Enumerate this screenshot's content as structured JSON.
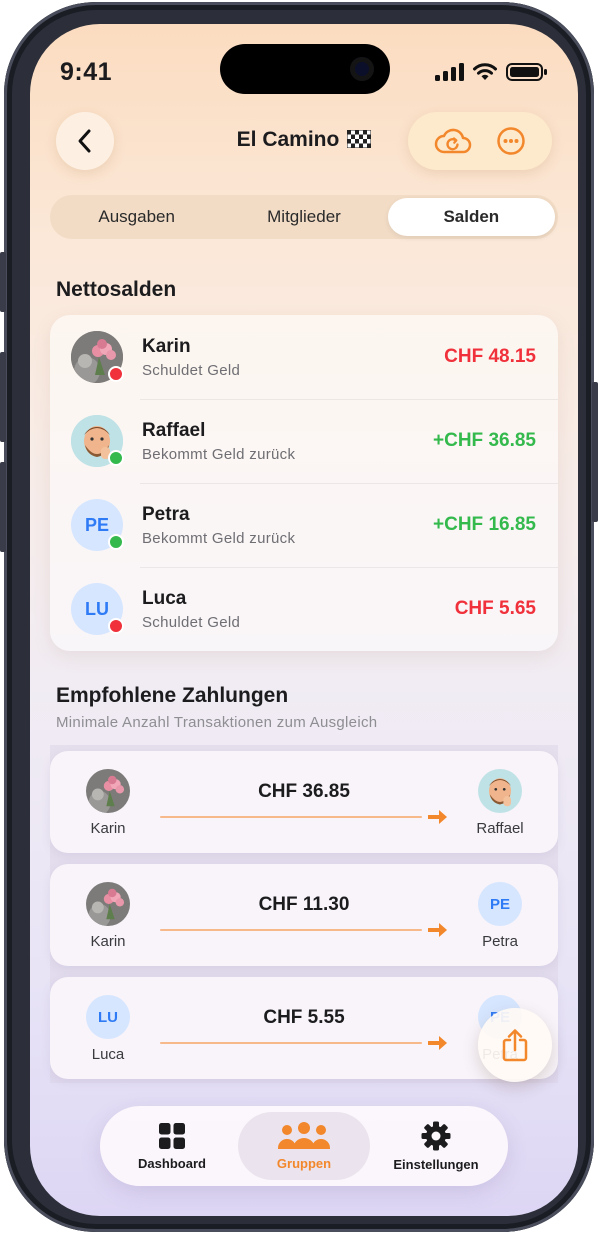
{
  "status_bar": {
    "time": "9:41"
  },
  "header": {
    "title": "El Camino",
    "flag_icon": "checkered-flag-icon"
  },
  "tabs": [
    {
      "label": "Ausgaben",
      "active": false
    },
    {
      "label": "Mitglieder",
      "active": false
    },
    {
      "label": "Salden",
      "active": true
    }
  ],
  "balances": {
    "title": "Nettosalden",
    "rows": [
      {
        "name": "Karin",
        "status": "Schuldet Geld",
        "amount": "CHF 48.15",
        "kind": "negative",
        "avatar": "photo-flowers"
      },
      {
        "name": "Raffael",
        "status": "Bekommt Geld zurück",
        "amount": "+CHF 36.85",
        "kind": "positive",
        "avatar": "memoji"
      },
      {
        "name": "Petra",
        "status": "Bekommt Geld zurück",
        "amount": "+CHF 16.85",
        "kind": "positive",
        "avatar": "PE"
      },
      {
        "name": "Luca",
        "status": "Schuldet Geld",
        "amount": "CHF 5.65",
        "kind": "negative",
        "avatar": "LU"
      }
    ]
  },
  "payments": {
    "title": "Empfohlene Zahlungen",
    "subtitle": "Minimale Anzahl Transaktionen zum Ausgleich",
    "items": [
      {
        "from": "Karin",
        "to": "Raffael",
        "amount": "CHF 36.85"
      },
      {
        "from": "Karin",
        "to": "Petra",
        "amount": "CHF 11.30"
      },
      {
        "from": "Luca",
        "to": "Petra",
        "amount": "CHF 5.55"
      }
    ],
    "initials": {
      "petra": "PE",
      "luca": "LU"
    }
  },
  "nav": [
    {
      "label": "Dashboard",
      "icon": "grid-icon",
      "active": false
    },
    {
      "label": "Gruppen",
      "icon": "people-icon",
      "active": true
    },
    {
      "label": "Einstellungen",
      "icon": "gear-icon",
      "active": false
    }
  ],
  "colors": {
    "accent": "#F2872B",
    "negative": "#F0303A",
    "positive": "#34B94D",
    "initials_bg": "#D6E6FF",
    "initials_text": "#2F7BF5"
  }
}
